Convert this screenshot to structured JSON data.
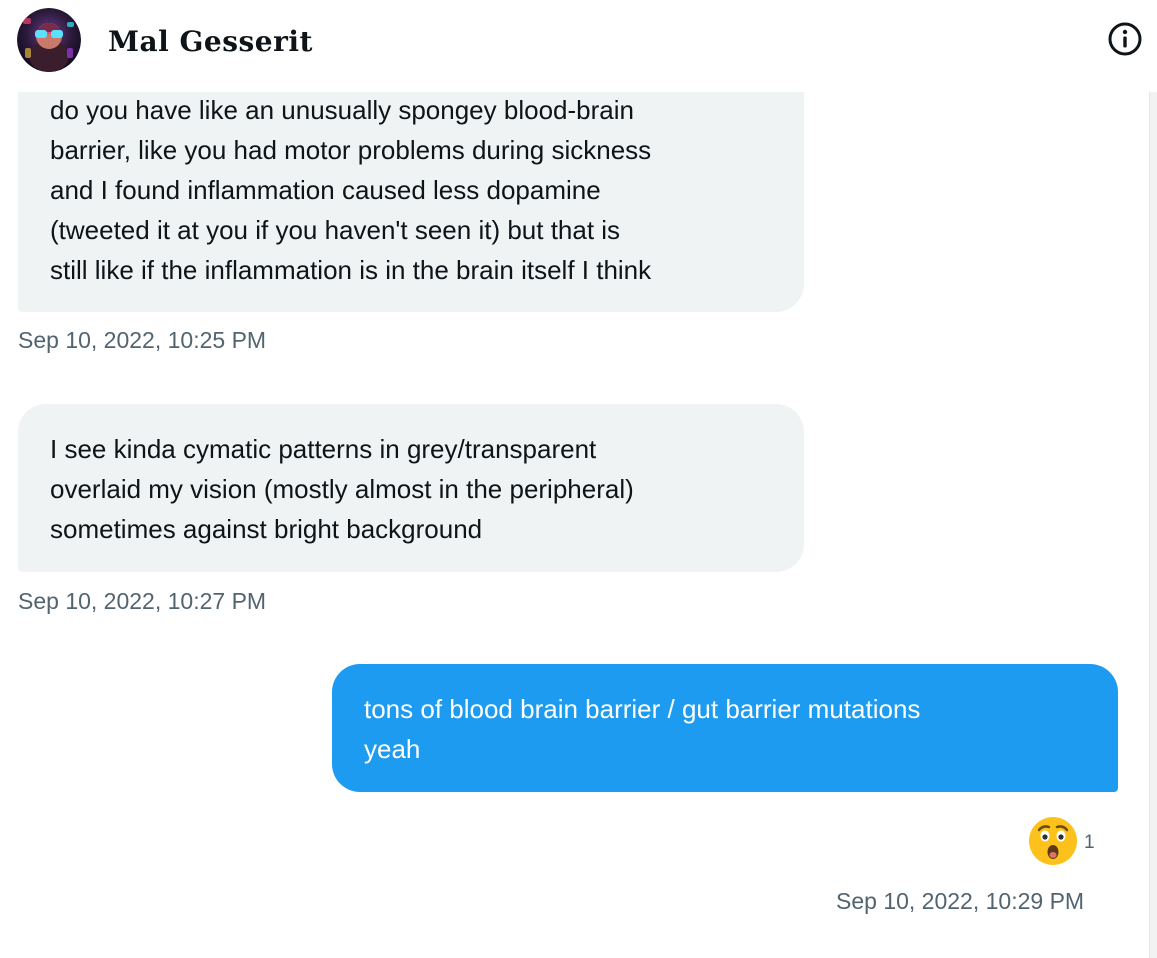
{
  "header": {
    "contact_name": "Mal Gesserit",
    "avatar_icon": "avatar-image",
    "info_icon": "info-icon"
  },
  "messages": [
    {
      "direction": "received",
      "lines": [
        "do you have like an unusually spongey blood-brain",
        "barrier, like you had motor problems during sickness",
        "and I found inflammation caused less dopamine",
        "(tweeted it at you if you haven't seen it) but that is",
        "still like if the inflammation is in the brain itself I think"
      ],
      "timestamp": "Sep 10, 2022, 10:25 PM"
    },
    {
      "direction": "received",
      "lines": [
        "I see kinda cymatic patterns in grey/transparent",
        "overlaid my vision (mostly almost in the peripheral)",
        "sometimes against bright background"
      ],
      "timestamp": "Sep 10, 2022, 10:27 PM"
    },
    {
      "direction": "sent",
      "lines": [
        "tons of blood brain barrier / gut barrier mutations",
        "yeah"
      ],
      "reaction": {
        "emoji_icon": "astonished-face-icon",
        "count": "1"
      },
      "timestamp": "Sep 10, 2022, 10:29 PM"
    }
  ],
  "colors": {
    "sent_bubble": "#1d9bf0",
    "received_bubble": "#eff3f4",
    "timestamp_text": "#536471",
    "primary_text": "#0f1419"
  }
}
